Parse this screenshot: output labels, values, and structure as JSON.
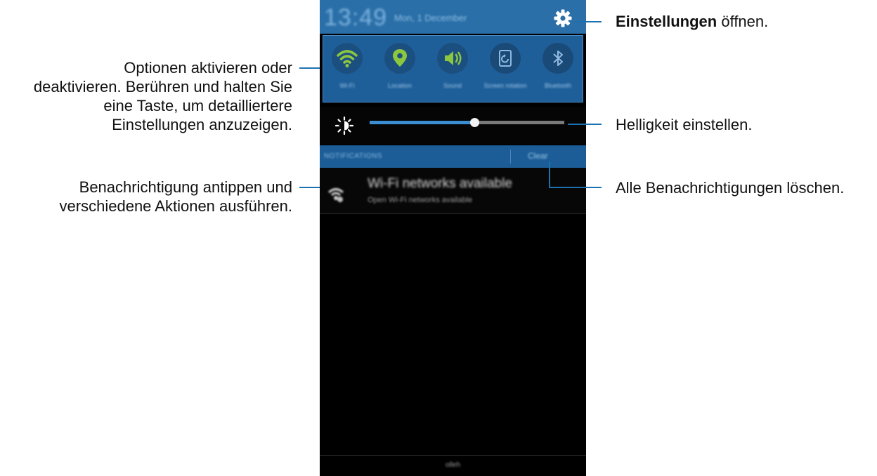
{
  "statusbar": {
    "time": "13:49",
    "date": "Mon, 1 December",
    "settings_icon": "gear-icon"
  },
  "quick_settings": [
    {
      "label": "Wi-Fi",
      "icon": "wifi-icon",
      "active": true
    },
    {
      "label": "Location",
      "icon": "location-pin-icon",
      "active": true
    },
    {
      "label": "Sound",
      "icon": "speaker-icon",
      "active": true
    },
    {
      "label": "Screen rotation",
      "icon": "screen-rotation-icon",
      "active": false
    },
    {
      "label": "Bluetooth",
      "icon": "bluetooth-icon",
      "active": false
    }
  ],
  "brightness": {
    "icon": "brightness-icon",
    "level": 0.54
  },
  "notifications": {
    "header": "NOTIFICATIONS",
    "clear_label": "Clear",
    "items": [
      {
        "title": "Wi-Fi networks available",
        "subtitle": "Open Wi-Fi networks available",
        "icon": "wifi-networks-icon"
      }
    ]
  },
  "footer": {
    "label": "olleh"
  },
  "annotations": {
    "settings_bold": "Einstellungen",
    "settings_rest": " öffnen.",
    "toggle_lines": [
      "Optionen aktivieren oder",
      "deaktivieren. Berühren und halten Sie",
      "eine Taste, um detailliertere",
      "Einstellungen anzuzeigen."
    ],
    "brightness": "Helligkeit einstellen.",
    "notification_lines": [
      "Benachrichtigung antippen und",
      "verschiedene Aktionen ausführen."
    ],
    "clear": "Alle Benachrichtigungen löschen."
  },
  "colors": {
    "statusbar": "#2a6fa8",
    "quick_panel": "#1f5f99",
    "active_icon": "#8dc63f",
    "inactive_icon": "#8fb9e0",
    "leader_line": "#1b72b3",
    "slider_fill": "#3a8ed1"
  }
}
